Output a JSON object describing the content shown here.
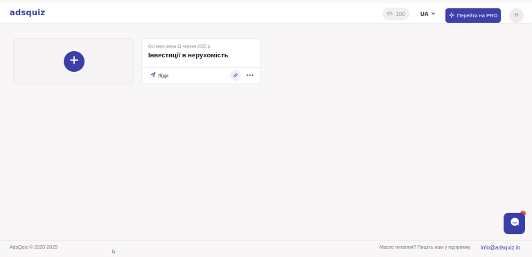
{
  "header": {
    "logo": "adsquiz",
    "credits": "100",
    "credits_icon": "crown-icon",
    "language": "UA",
    "pro_button": "Перейти на PRO",
    "avatar_initial": "Н"
  },
  "dashboard": {
    "add_quiz_icon": "plus-icon",
    "quizzes": [
      {
        "last_change": "Остання зміна 11 червня 2025 р.",
        "title": "Інвестиції в нерухомість",
        "leads_label": "Ліди"
      }
    ]
  },
  "footer": {
    "copyright": "AdsQuiz © 2020-2025",
    "question": "Маєте питання? Пишіть нам у підтримку",
    "email": "info@adsquiz.io"
  },
  "colors": {
    "brand": "#3d40ad",
    "background": "#f8f6f7",
    "notification": "#e5533f"
  }
}
